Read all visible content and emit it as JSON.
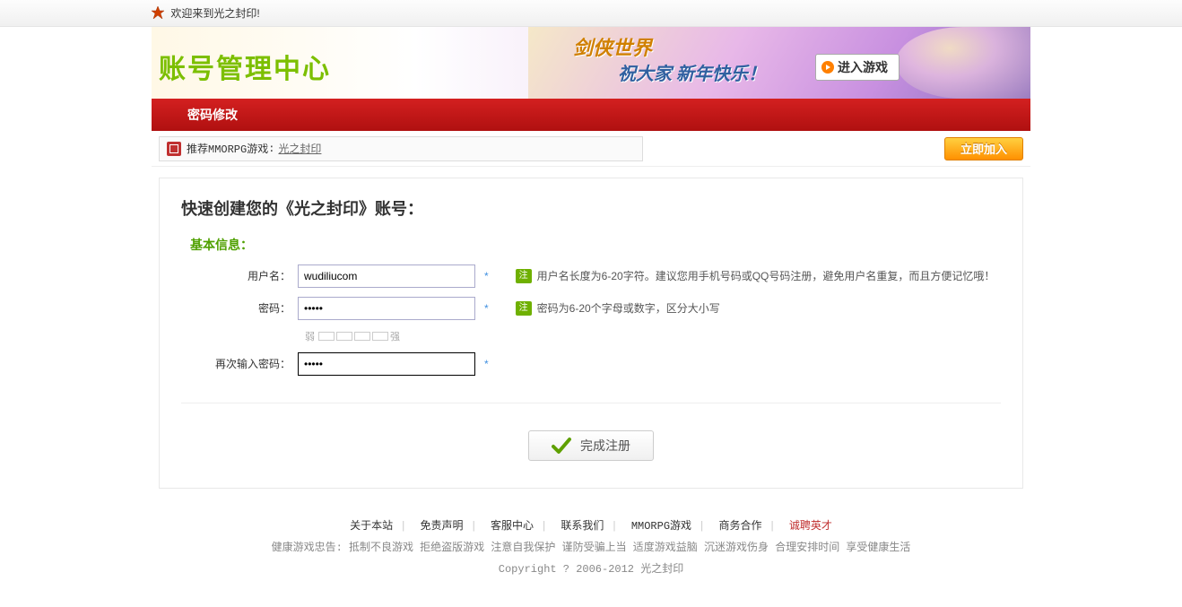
{
  "topbar": {
    "welcome": "欢迎来到光之封印!"
  },
  "header": {
    "logo": "账号管理中心",
    "banner_line1": "剑侠世界",
    "banner_line2": "祝大家  新年快乐！",
    "enter_game": "进入游戏"
  },
  "redbar": {
    "title": "密码修改"
  },
  "recommend": {
    "label": "推荐MMORPG游戏",
    "sep": " :",
    "game": "光之封印",
    "join": "立即加入"
  },
  "form": {
    "title": "快速创建您的《光之封印》账号：",
    "section": "基本信息：",
    "username_label": "用户名：",
    "username_value": "wudiliucom",
    "username_hint": "用户名长度为6-20字符。建议您用手机号码或QQ号码注册，避免用户名重复，而且方便记忆哦！",
    "password_label": "密码：",
    "password_value": "•••••",
    "password_hint": "密码为6-20个字母或数字，区分大小写",
    "strength_weak": "弱",
    "strength_strong": "强",
    "confirm_label": "再次输入密码：",
    "confirm_value": "•••••",
    "hint_badge": "注",
    "star": "*",
    "submit": "完成注册"
  },
  "footer": {
    "links": [
      "关于本站",
      "免责声明",
      "客服中心",
      "联系我们",
      "MMORPG游戏",
      "商务合作"
    ],
    "highlight_link": "诚聘英才",
    "advice": "健康游戏忠告: 抵制不良游戏 拒绝盗版游戏 注意自我保护 谨防受骗上当 适度游戏益脑 沉迷游戏伤身 合理安排时间 享受健康生活",
    "copyright": "Copyright ? 2006-2012 光之封印"
  }
}
